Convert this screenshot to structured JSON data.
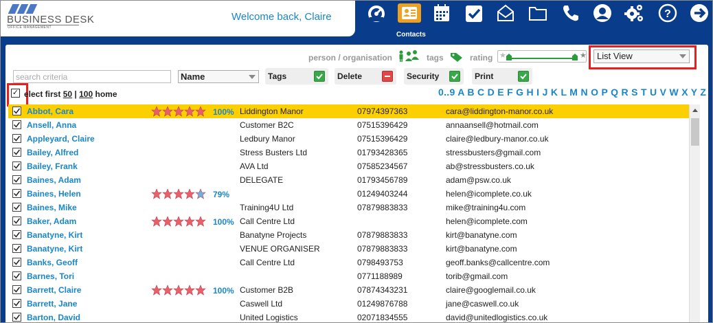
{
  "header": {
    "logo_title": "BUSINESS DESK",
    "logo_subtitle": "OFFICE MANAGEMENT",
    "welcome": "Welcome back, Claire"
  },
  "nav": {
    "items": [
      {
        "icon": "dashboard-icon"
      },
      {
        "icon": "contacts-icon",
        "label": "Contacts",
        "active": true
      },
      {
        "icon": "calendar-icon"
      },
      {
        "icon": "tasks-checkbox-icon"
      },
      {
        "icon": "mail-icon"
      },
      {
        "icon": "folder-icon"
      },
      {
        "icon": "phone-icon"
      },
      {
        "icon": "user-profile-icon"
      },
      {
        "icon": "settings-gears-icon"
      },
      {
        "icon": "help-icon"
      },
      {
        "icon": "logout-arrow-icon"
      }
    ]
  },
  "filters": {
    "person_org": "person / organisation",
    "tags": "tags",
    "rating": "rating",
    "view_select": "List View"
  },
  "search": {
    "placeholder": "search criteria",
    "field_select": "Name"
  },
  "toggles": {
    "tags": "Tags",
    "delete": "Delete",
    "security": "Security",
    "print": "Print"
  },
  "select_first": {
    "prefix": "elect first",
    "opt1": "50",
    "sep": "|",
    "opt2": "100",
    "suffix": "home"
  },
  "alphabet": [
    "0..9",
    "A",
    "B",
    "C",
    "D",
    "E",
    "F",
    "G",
    "H",
    "I",
    "J",
    "K",
    "L",
    "M",
    "N",
    "O",
    "P",
    "Q",
    "R",
    "S",
    "T",
    "U",
    "V",
    "W",
    "X",
    "Y",
    "Z"
  ],
  "colors": {
    "brand_blue": "#0a3c8c",
    "link_blue": "#1a86c8",
    "highlight": "#fcd000",
    "active_nav": "#f0a020",
    "star_red": "#e8606a",
    "star_blue": "#6ab0e0"
  },
  "contacts": [
    {
      "name": "Abbot, Cara",
      "stars": 5,
      "rating": "100%",
      "org": "Liddington Manor",
      "phone": "07974397363",
      "email": "cara@liddington-manor.co.uk",
      "highlight": true
    },
    {
      "name": "Ansell, Anna",
      "stars": 0,
      "rating": "",
      "org": "Customer B2C",
      "phone": "07515396429",
      "email": "annaansell@hotmail.com"
    },
    {
      "name": "Appleyard, Claire",
      "stars": 0,
      "rating": "",
      "org": "Ledbury Manor",
      "phone": "07515396429",
      "email": "claire@ledbury-manor.co.uk"
    },
    {
      "name": "Bailey, Alfred",
      "stars": 0,
      "rating": "",
      "org": "Stress Busters Ltd",
      "phone": "01793428365",
      "email": "stressbusters@gmail.com"
    },
    {
      "name": "Bailey, Frank",
      "stars": 0,
      "rating": "",
      "org": "AVA Ltd",
      "phone": "07585234567",
      "email": "ab@stressbusters.co.uk"
    },
    {
      "name": "Baines, Adam",
      "stars": 0,
      "rating": "",
      "org": "DELEGATE",
      "phone": "01793456789",
      "email": "adam@psw.co.uk"
    },
    {
      "name": "Baines, Helen",
      "stars": 4,
      "rating": "79%",
      "org": "",
      "phone": "01249403244",
      "email": "helen@icomplete.co.uk"
    },
    {
      "name": "Baines, Mike",
      "stars": 0,
      "rating": "",
      "org": "Training4U Ltd",
      "phone": "07879883833",
      "email": "mike@training4u.com"
    },
    {
      "name": "Baker, Adam",
      "stars": 5,
      "rating": "100%",
      "org": "Call Centre Ltd",
      "phone": "",
      "email": "helen@icomplete.com"
    },
    {
      "name": "Banatyne, Kirt",
      "stars": 0,
      "rating": "",
      "org": "Banatyne Projects",
      "phone": "07879883833",
      "email": "kirt@banatyne.com"
    },
    {
      "name": "Banatyne, Kirt",
      "stars": 0,
      "rating": "",
      "org": "VENUE ORGANISER",
      "phone": "07879883833",
      "email": "kirt@banatyne.com"
    },
    {
      "name": "Banks, Geoff",
      "stars": 0,
      "rating": "",
      "org": "Call Centre Ltd",
      "phone": "0798493753",
      "email": "geoff.banks@callcentre.com"
    },
    {
      "name": "Barnes, Tori",
      "stars": 0,
      "rating": "",
      "org": "",
      "phone": "0771188989",
      "email": "torib@gmail.com"
    },
    {
      "name": "Barrett, Claire",
      "stars": 5,
      "rating": "100%",
      "org": "Customer B2B",
      "phone": "07874343231",
      "email": "claire@googlemail.co.uk"
    },
    {
      "name": "Barrett, Jane",
      "stars": 0,
      "rating": "",
      "org": "Caswell Ltd",
      "phone": "01249876788",
      "email": "jane@caswell.co.uk"
    },
    {
      "name": "Barton, David",
      "stars": 0,
      "rating": "",
      "org": "United Logistics",
      "phone": "02071834555",
      "email": "david@unitedlogistics.co.uk"
    }
  ]
}
